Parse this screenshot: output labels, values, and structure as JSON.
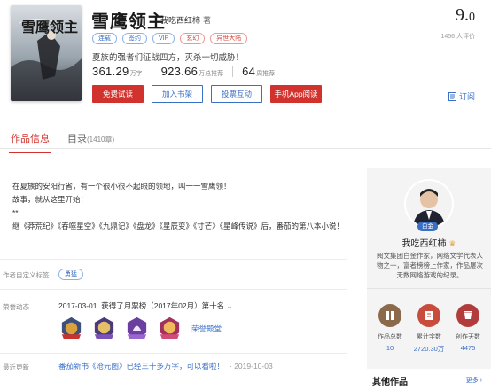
{
  "book": {
    "title": "雪鹰领主",
    "author": "我吃西红柿",
    "author_role": "著",
    "tags": [
      {
        "label": "连载",
        "tone": "blue"
      },
      {
        "label": "签约",
        "tone": "blue"
      },
      {
        "label": "VIP",
        "tone": "blue"
      },
      {
        "label": "玄幻",
        "tone": "red"
      },
      {
        "label": "异世大陆",
        "tone": "red"
      }
    ],
    "intro": "夏族的强者们征战四方，灭杀一切威胁！",
    "stats": [
      {
        "value": "361.29",
        "unit": "万字"
      },
      {
        "value": "923.66",
        "unit": "万总推荐"
      },
      {
        "value": "64",
        "unit": "周推荐"
      }
    ],
    "score_main": "9.",
    "score_decimal": "0",
    "score_count": "1456 人评价",
    "cover_text": "雪鹰领主"
  },
  "actions": {
    "free_read": "免费试读",
    "add_shelf": "加入书架",
    "tip": "投票互动",
    "mobile_read": "手机App阅读",
    "subscribe": "订阅"
  },
  "tabs": {
    "info": "作品信息",
    "catalog": "目录",
    "catalog_count": "(1410章)"
  },
  "description": {
    "lines": [
      "在夏族的安阳行省，有一个很小很不起眼的领地，叫一一雪鹰领！",
      "故事，就从这里开始！",
      "**",
      "继《莽荒纪》《吞噬星空》《九鼎记》《盘龙》《星辰变》《寸芒》《星峰传说》后，番茄的第八本小说！"
    ]
  },
  "author_tags": {
    "label": "作者自定义标签",
    "tag": "勇猛"
  },
  "honors": {
    "label": "荣誉动态",
    "date": "2017-03-01",
    "text": "获得了月票榜（2017年02月）第十名",
    "link": "荣誉殿堂"
  },
  "latest_update": {
    "label": "最近更新",
    "text": "番茄新书《沧元图》已经三十多万字，可以看啦！",
    "date": "· 2019-10-03"
  },
  "author_card": {
    "badge": "白金",
    "name": "我吃西红柿",
    "desc": "阅文集团白金作家，网络文学代表人物之一，富者榜榜上作家，作品屡次无数网络游戏的纪录。",
    "stats": [
      {
        "label": "作品总数",
        "value": "10",
        "icon": "books-icon",
        "color": "#8a6a4a"
      },
      {
        "label": "累计字数",
        "value": "2720.30万",
        "icon": "document-icon",
        "color": "#c84b3c"
      },
      {
        "label": "创作天数",
        "value": "4475",
        "icon": "cup-icon",
        "color": "#b23c3c"
      }
    ]
  },
  "other_works": {
    "title": "其他作品",
    "more": "更多"
  }
}
